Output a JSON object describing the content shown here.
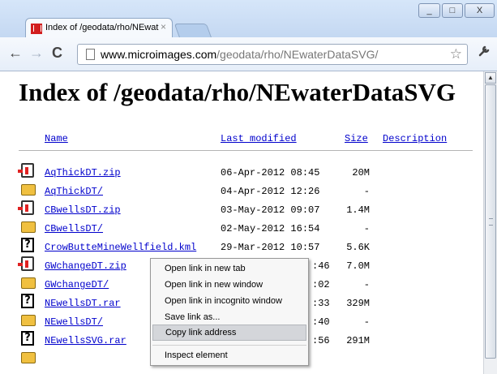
{
  "browser": {
    "tab_title": "Index of /geodata/rho/NEwat",
    "tab_close": "×",
    "window_buttons": {
      "minimize": "_",
      "maximize": "□",
      "close": "X"
    },
    "nav": {
      "back": "←",
      "forward": "→",
      "reload": "C"
    },
    "url_domain": "www.microimages.com",
    "url_path": "/geodata/rho/NEwaterDataSVG/",
    "star": "☆",
    "wrench": "🔧"
  },
  "page": {
    "title": "Index of /geodata/rho/NEwaterDataSVG",
    "columns": {
      "name": "Name",
      "modified": "Last modified",
      "size": "Size",
      "description": "Description"
    },
    "rows": [
      {
        "type": "zip",
        "name": "AqThickDT.zip",
        "modified": "06-Apr-2012 08:45",
        "size": "20M"
      },
      {
        "type": "folder",
        "name": "AqThickDT/",
        "modified": "04-Apr-2012 12:26",
        "size": "-"
      },
      {
        "type": "zip",
        "name": "CBwellsDT.zip",
        "modified": "03-May-2012 09:07",
        "size": "1.4M"
      },
      {
        "type": "folder",
        "name": "CBwellsDT/",
        "modified": "02-May-2012 16:54",
        "size": "-"
      },
      {
        "type": "unknown",
        "name": "CrowButteMineWellfield.kml",
        "modified": "29-Mar-2012 10:57",
        "size": "5.6K"
      },
      {
        "type": "zip",
        "name": "GWchangeDT.zip",
        "modified": ":46",
        "size": "7.0M"
      },
      {
        "type": "folder",
        "name": "GWchangeDT/",
        "modified": ":02",
        "size": "-"
      },
      {
        "type": "unknown",
        "name": "NEwellsDT.rar",
        "modified": ":33",
        "size": "329M"
      },
      {
        "type": "folder",
        "name": "NEwellsDT/",
        "modified": ":40",
        "size": "-"
      },
      {
        "type": "unknown",
        "name": "NEwellsSVG.rar",
        "modified": ":56",
        "size": "291M"
      }
    ]
  },
  "context_menu": {
    "items": [
      "Open link in new tab",
      "Open link in new window",
      "Open link in incognito window",
      "Save link as...",
      "Copy link address",
      "Inspect element"
    ],
    "highlighted": "Copy link address"
  }
}
